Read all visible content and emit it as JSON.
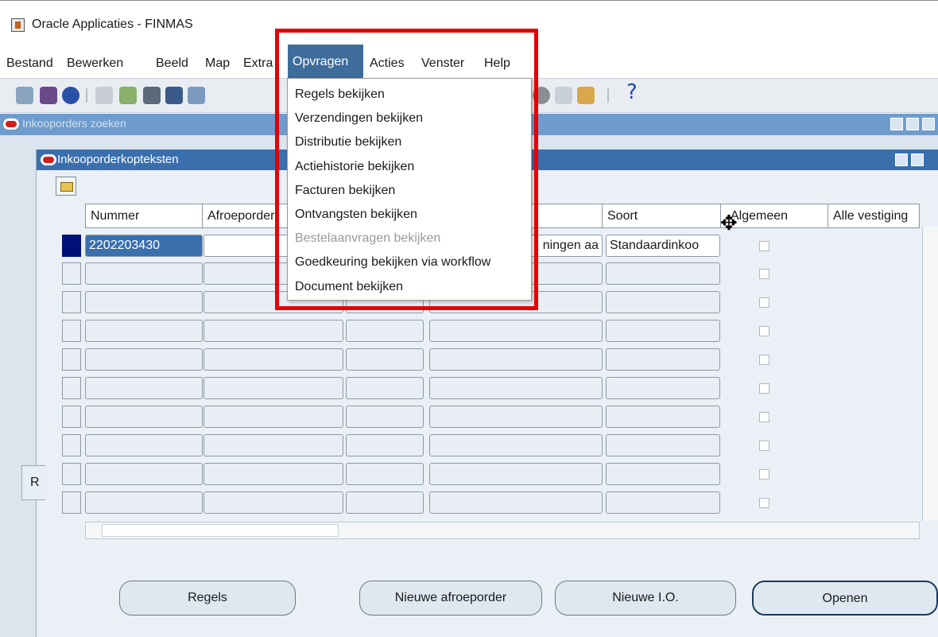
{
  "window": {
    "title": "Oracle Applicaties - FINMAS"
  },
  "menubar": {
    "items": [
      "Bestand",
      "Bewerken",
      "Beeld",
      "Map",
      "Extra",
      "Opvragen",
      "Acties",
      "Venster",
      "Help"
    ]
  },
  "toolbar": {
    "help_glyph": "?"
  },
  "outer_window": {
    "title": "Inkooporders zoeken"
  },
  "inner_window": {
    "title": "Inkooporderkopteksten"
  },
  "table": {
    "headers": [
      "Nummer",
      "Afroeporder",
      "",
      "",
      "Soort",
      "Algemeen",
      "Alle vestiging"
    ],
    "rows": [
      {
        "nummer": "2202203430",
        "afroep": "",
        "c3": "",
        "c4": "ningen aa",
        "soort": "Standaardinkoo"
      }
    ]
  },
  "tab": {
    "label": "R"
  },
  "buttons": {
    "regels": "Regels",
    "nieuwe_afroep": "Nieuwe afroeporder",
    "nieuwe_io": "Nieuwe I.O.",
    "openen": "Openen"
  },
  "dropdown": {
    "items": [
      {
        "label": "Regels bekijken",
        "enabled": true
      },
      {
        "label": "Verzendingen bekijken",
        "enabled": true
      },
      {
        "label": "Distributie bekijken",
        "enabled": true
      },
      {
        "label": "Actiehistorie bekijken",
        "enabled": true
      },
      {
        "label": "Facturen bekijken",
        "enabled": true
      },
      {
        "label": "Ontvangsten bekijken",
        "enabled": true
      },
      {
        "label": "Bestelaanvragen bekijken",
        "enabled": false
      },
      {
        "label": "Goedkeuring bekijken via workflow",
        "enabled": true
      },
      {
        "label": "Document bekijken",
        "enabled": true
      }
    ]
  },
  "colors": {
    "highlight_menu": "#3e6d9c",
    "annotation": "#e60000",
    "title_blue": "#3a6fae"
  }
}
